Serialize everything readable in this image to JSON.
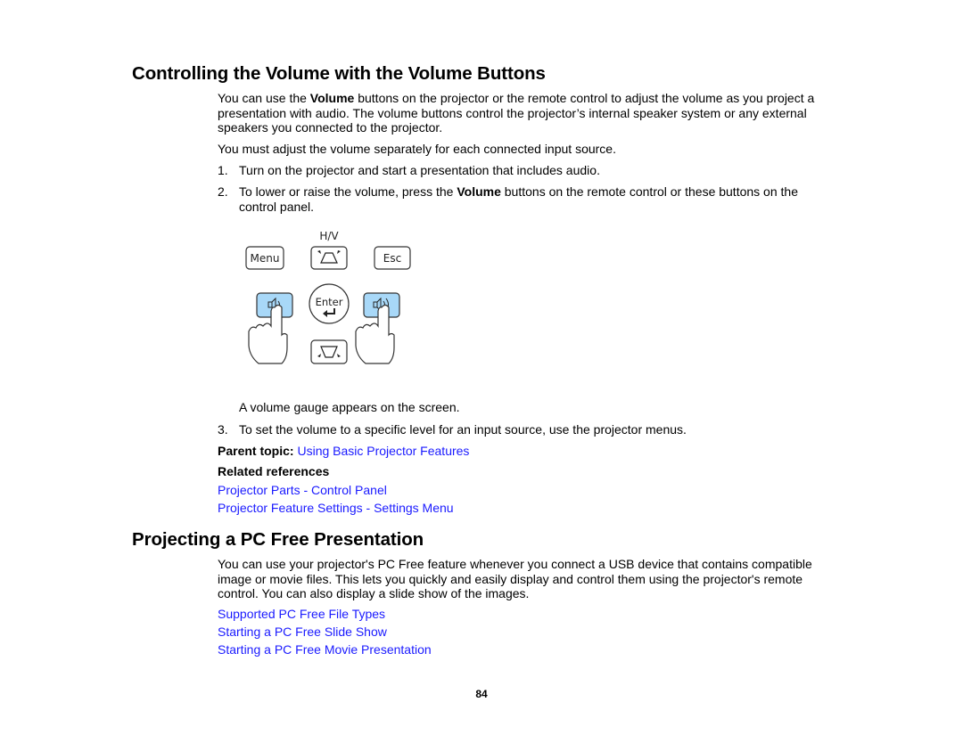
{
  "section1": {
    "title": "Controlling the Volume with the Volume Buttons",
    "intro_pre": "You can use the ",
    "intro_bold": "Volume",
    "intro_post": " buttons on the projector or the remote control to adjust the volume as you project a presentation with audio. The volume buttons control the projector’s internal speaker system or any external speakers you connected to the projector.",
    "note": "You must adjust the volume separately for each connected input source.",
    "steps": [
      {
        "num": "1.",
        "text": "Turn on the projector and start a presentation that includes audio."
      },
      {
        "num": "2.",
        "text_pre": "To lower or raise the volume, press the ",
        "text_bold": "Volume",
        "text_post": " buttons on the remote control or these buttons on the control panel."
      },
      {
        "num": "3.",
        "text": "To set the volume to a specific level for an input source, use the projector menus."
      }
    ],
    "figure": {
      "hv_label": "H/V",
      "menu_label": "Menu",
      "esc_label": "Esc",
      "enter_label": "Enter",
      "highlight_color": "#a8d8f8"
    },
    "step2_result": "A volume gauge appears on the screen.",
    "parent_topic_label": "Parent topic:",
    "parent_topic_link": "Using Basic Projector Features",
    "related_heading": "Related references",
    "related_links": [
      "Projector Parts - Control Panel",
      "Projector Feature Settings - Settings Menu"
    ]
  },
  "section2": {
    "title": "Projecting a PC Free Presentation",
    "intro": "You can use your projector's PC Free feature whenever you connect a USB device that contains compatible image or movie files. This lets you quickly and easily display and control them using the projector's remote control. You can also display a slide show of the images.",
    "links": [
      "Supported PC Free File Types",
      "Starting a PC Free Slide Show",
      "Starting a PC Free Movie Presentation"
    ]
  },
  "page_number": "84",
  "colors": {
    "link": "#1a1aff"
  }
}
